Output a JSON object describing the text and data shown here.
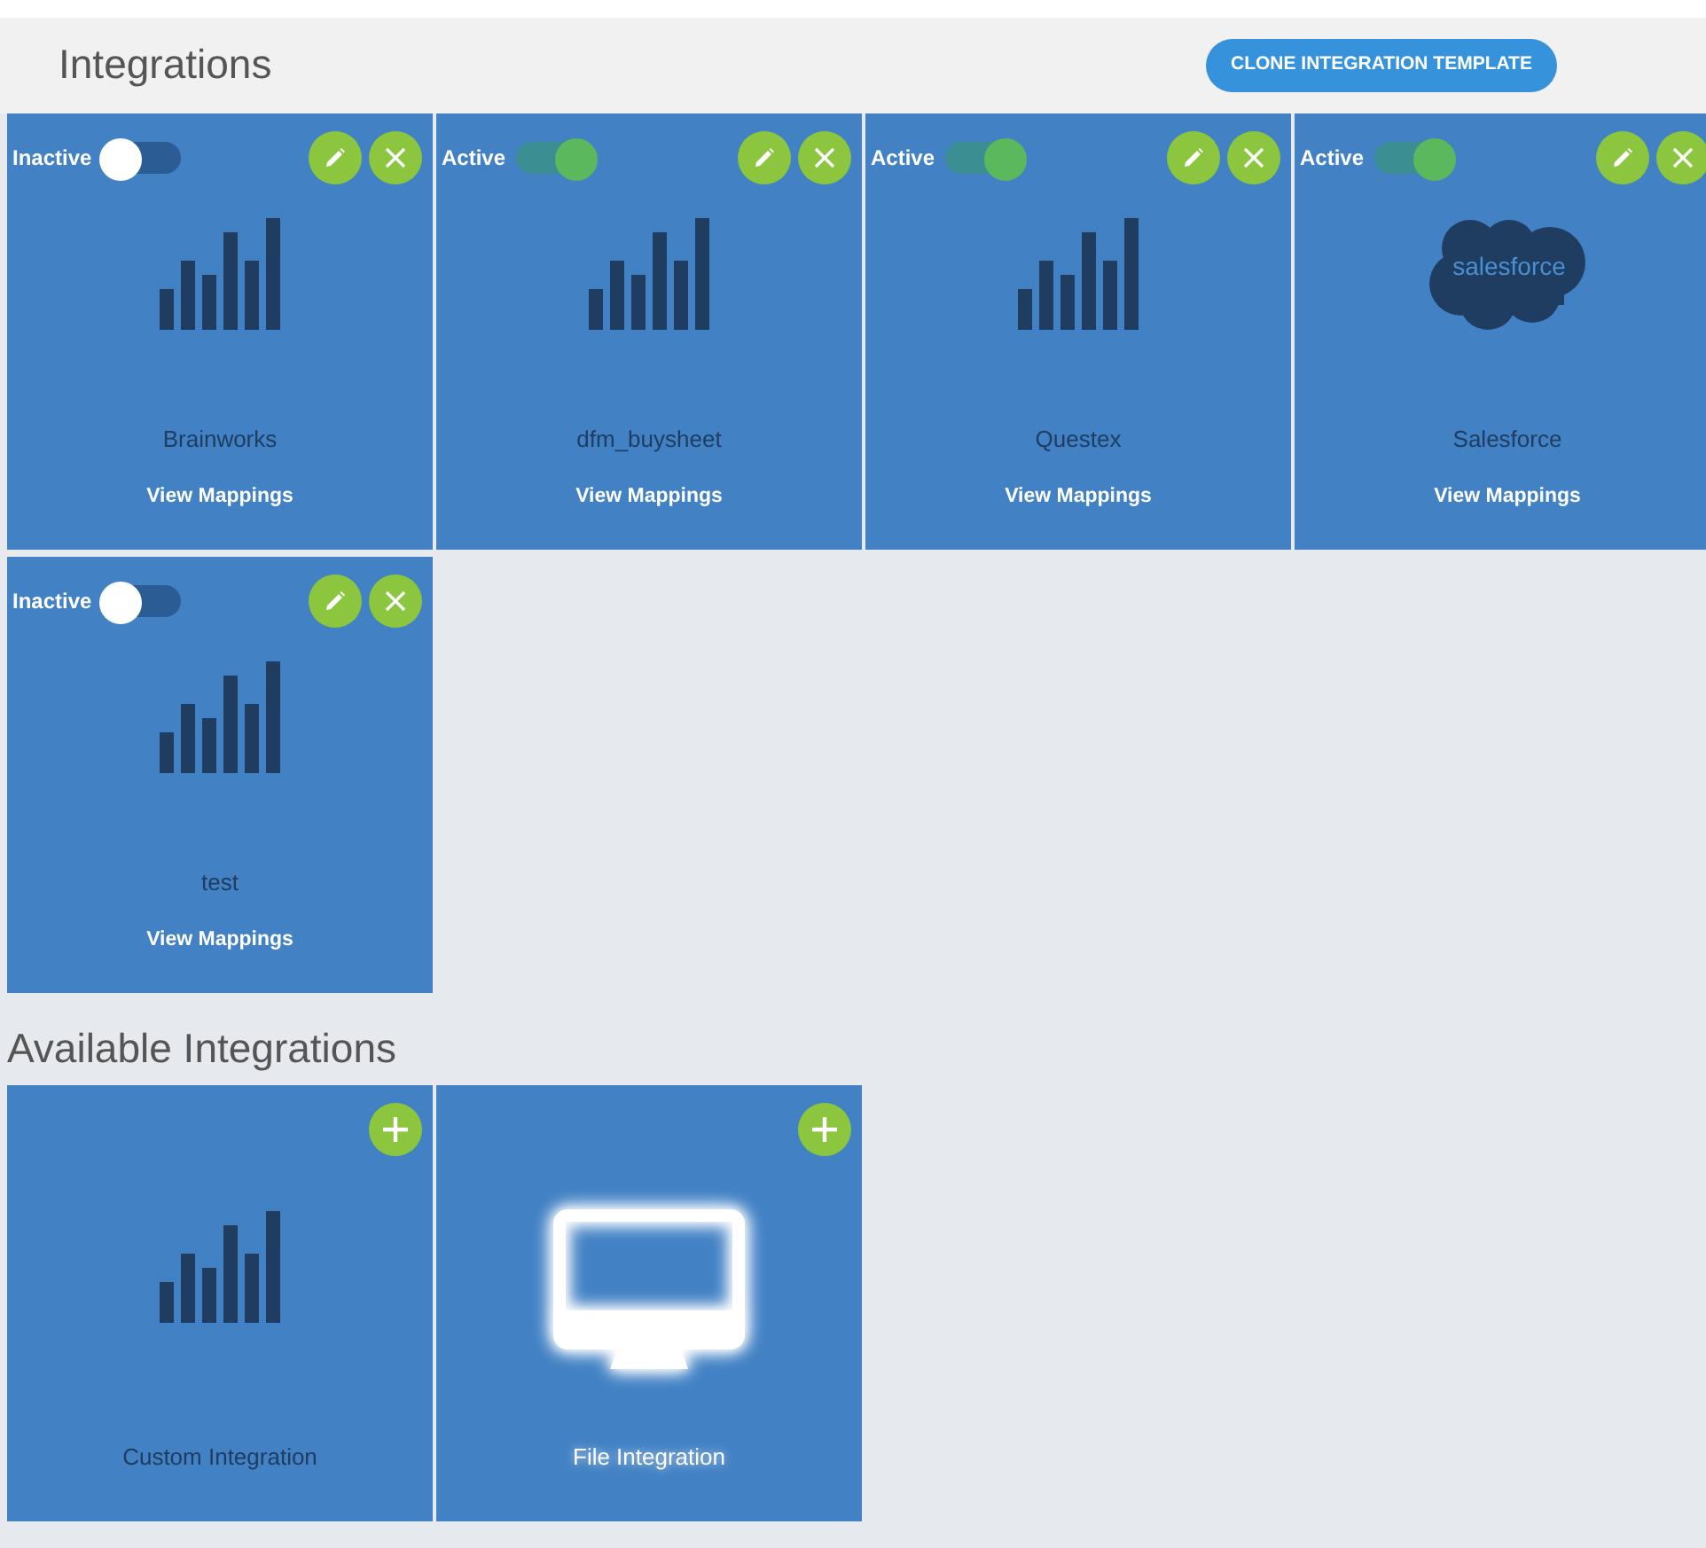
{
  "header": {
    "title": "Integrations",
    "clone_button": "CLONE INTEGRATION TEMPLATE"
  },
  "integrations": [
    {
      "name": "Brainworks",
      "status": "Inactive",
      "active": false,
      "kind": "chart",
      "link": "View Mappings"
    },
    {
      "name": "dfm_buysheet",
      "status": "Active",
      "active": true,
      "kind": "chart",
      "link": "View Mappings"
    },
    {
      "name": "Questex",
      "status": "Active",
      "active": true,
      "kind": "chart",
      "link": "View Mappings"
    },
    {
      "name": "Salesforce",
      "status": "Active",
      "active": true,
      "kind": "cloud",
      "logo_text": "salesforce",
      "link": "View Mappings"
    },
    {
      "name": "test",
      "status": "Inactive",
      "active": false,
      "kind": "chart",
      "link": "View Mappings"
    }
  ],
  "available_title": "Available Integrations",
  "available": [
    {
      "name": "Custom Integration",
      "kind": "chart",
      "hovered": false
    },
    {
      "name": "File Integration",
      "kind": "monitor",
      "hovered": true
    }
  ]
}
